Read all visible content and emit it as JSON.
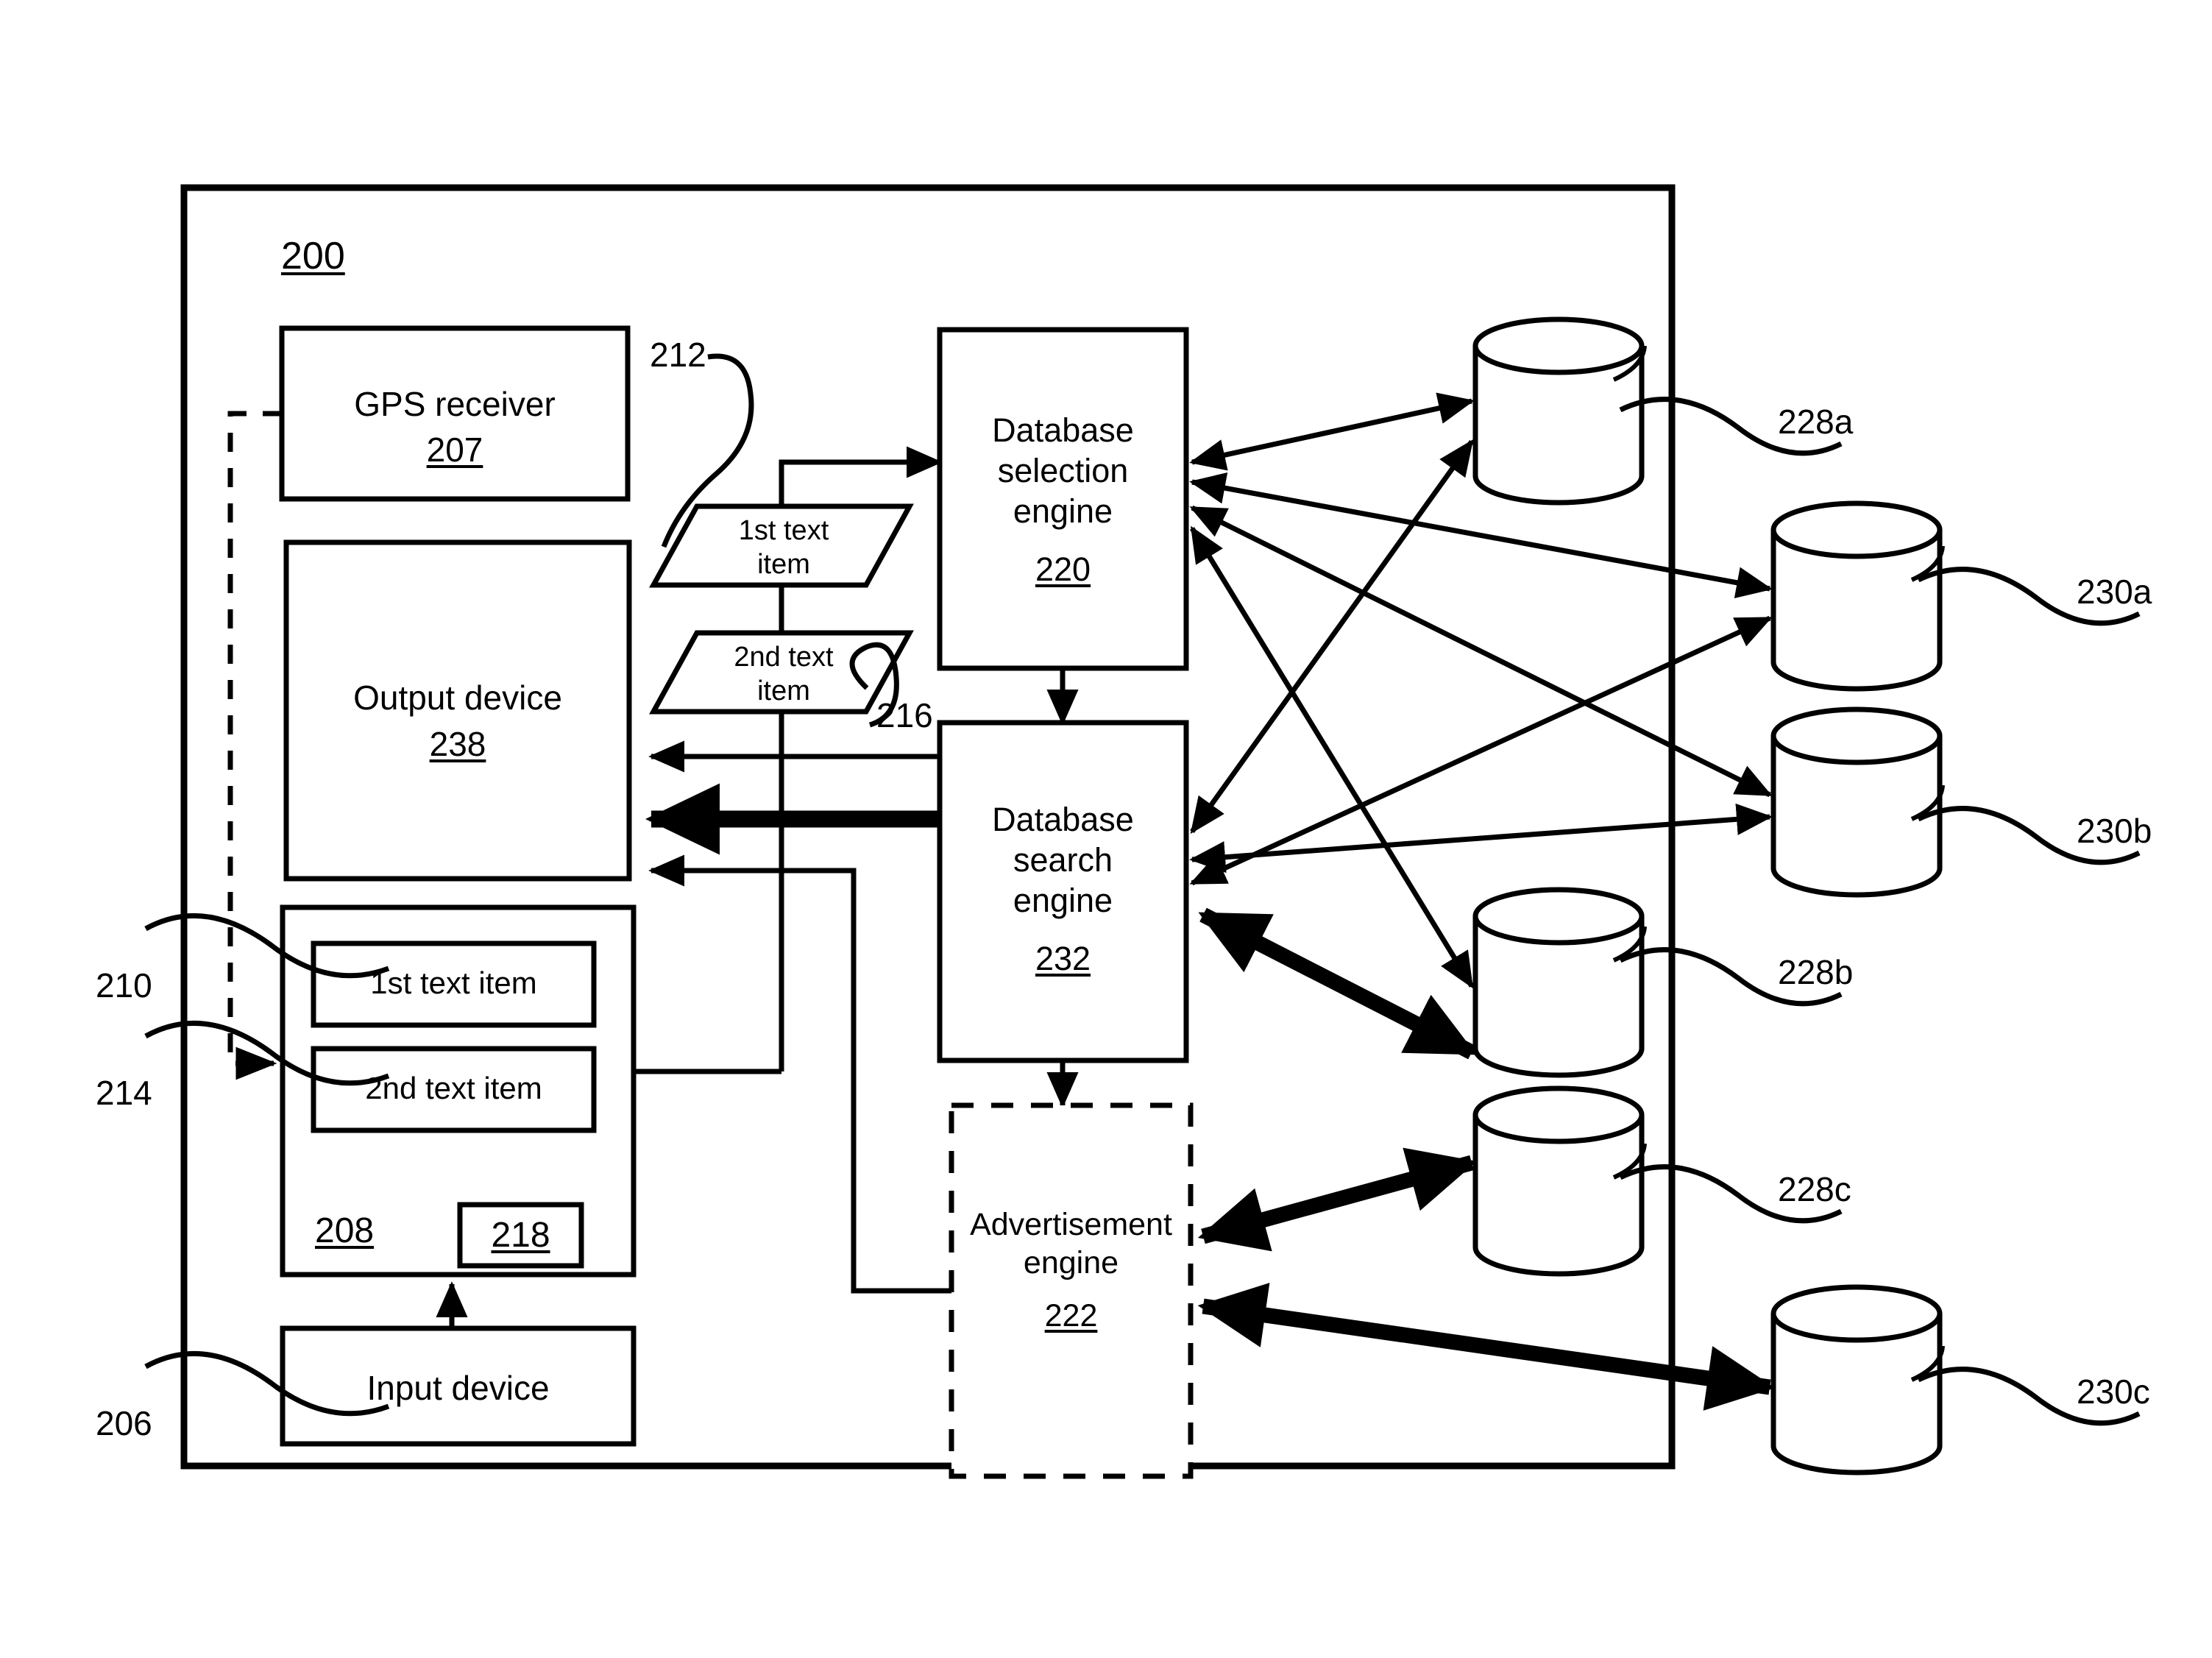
{
  "figure": {
    "figure_number": "200",
    "type": "patent-block-diagram"
  },
  "blocks": {
    "gps_receiver": {
      "title": "GPS receiver",
      "ref": "207"
    },
    "output_device": {
      "title": "Output device",
      "ref": "238"
    },
    "memory": {
      "ref": "208"
    },
    "memory_sub": {
      "ref": "218"
    },
    "first_text_item_stored": {
      "title": "1st text item"
    },
    "second_text_item_stored": {
      "title": "2nd text item"
    },
    "input_device": {
      "title": "Input device"
    },
    "first_text_item_flow": {
      "title": "1st text\nitem"
    },
    "second_text_item_flow": {
      "title": "2nd text\nitem"
    },
    "database_selection_engine": {
      "title": "Database\nselection\nengine",
      "ref": "220"
    },
    "database_search_engine": {
      "title": "Database\nsearch\nengine",
      "ref": "232"
    },
    "advertisement_engine": {
      "title": "Advertisement\nengine",
      "ref": "222"
    }
  },
  "databases": [
    {
      "ref": "228a"
    },
    {
      "ref": "230a"
    },
    {
      "ref": "230b"
    },
    {
      "ref": "228b"
    },
    {
      "ref": "228c"
    },
    {
      "ref": "230c"
    }
  ],
  "reference_numerals": {
    "figure": "200",
    "gps_link": "212",
    "second_text_link": "216",
    "first_text_item": "210",
    "second_text_item": "214",
    "input_device": "206"
  },
  "colors": {
    "stroke": "#000000",
    "background": "#ffffff"
  }
}
